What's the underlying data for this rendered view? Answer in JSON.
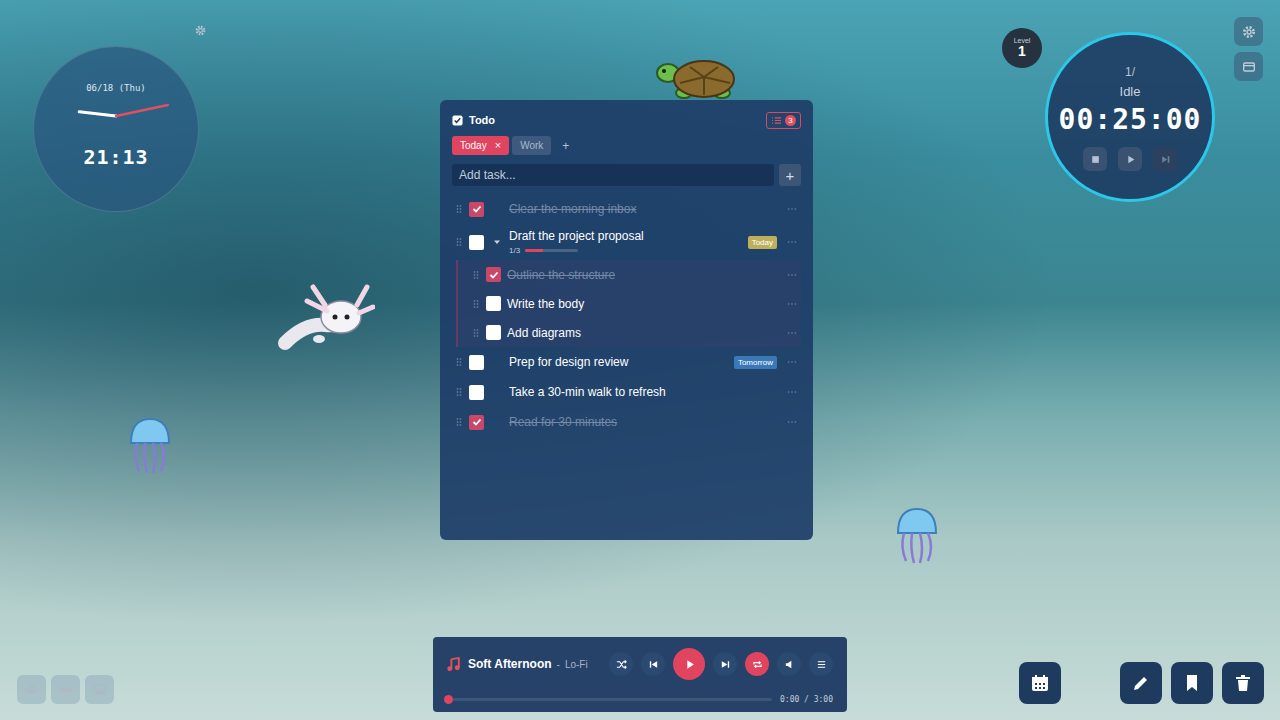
{
  "clock": {
    "date": "06/18 (Thu)",
    "time": "21:13"
  },
  "level_badge": {
    "label": "Level",
    "value": "1"
  },
  "timer": {
    "session": "1/",
    "status": "Idle",
    "time": "00:25:00"
  },
  "todo": {
    "title": "Todo",
    "badge": "3",
    "tabs": [
      {
        "label": "Today",
        "selected": true,
        "close": "×"
      },
      {
        "label": "Work",
        "selected": false,
        "close": ""
      }
    ],
    "add_tab": "+",
    "input": {
      "placeholder": "Add task..."
    },
    "add_button": "+",
    "tasks": [
      {
        "text": "Clear the morning inbox",
        "checked": true,
        "tag": null,
        "subtasks": []
      },
      {
        "text": "Draft the project proposal",
        "checked": false,
        "tag": {
          "label": "Today",
          "color": "#bfae5c"
        },
        "expanded": true,
        "progress": {
          "text": "1/3",
          "level": 0.33
        },
        "subtasks": [
          {
            "text": "Outline the structure",
            "checked": true
          },
          {
            "text": "Write the body",
            "checked": false
          },
          {
            "text": "Add diagrams",
            "checked": false
          }
        ]
      },
      {
        "text": "Prep for design review",
        "checked": false,
        "tag": {
          "label": "Tomorrow",
          "color": "#3b78b8"
        },
        "subtasks": []
      },
      {
        "text": "Take a 30-min walk to refresh",
        "checked": false,
        "tag": null,
        "subtasks": []
      },
      {
        "text": "Read for 30 minutes",
        "checked": true,
        "tag": null,
        "subtasks": []
      }
    ]
  },
  "music": {
    "title": "Soft Afternoon",
    "separator": "-",
    "genre": "Lo-Fi",
    "playing": false,
    "shuffle": false,
    "repeat": true,
    "level": 0.0,
    "time": "0:00 / 3:00"
  }
}
